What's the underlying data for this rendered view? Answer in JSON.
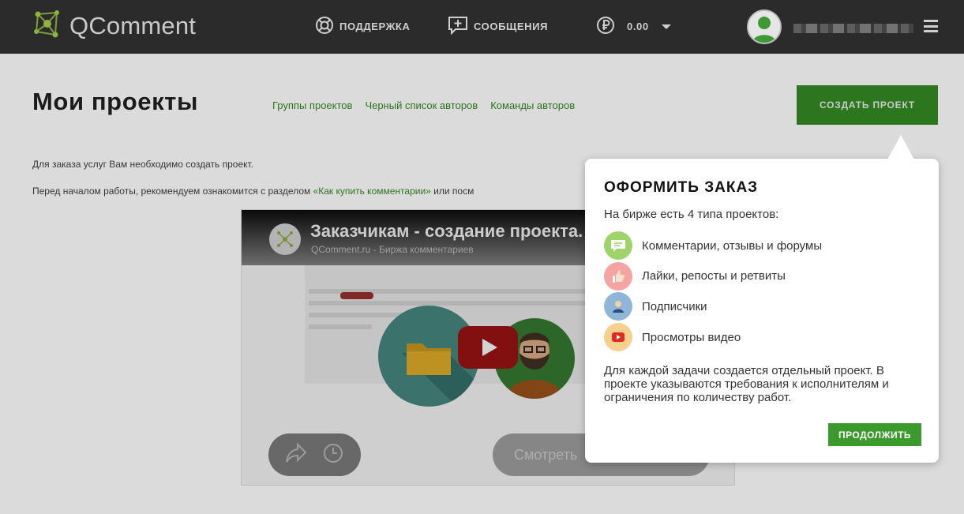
{
  "app": {
    "name": "QComment"
  },
  "header": {
    "nav": {
      "support": "ПОДДЕРЖКА",
      "messages": "СООБЩЕНИЯ",
      "balance": "0.00"
    }
  },
  "main": {
    "title": "Мои проекты",
    "links": [
      "Группы проектов",
      "Черный список авторов",
      "Команды авторов"
    ],
    "create_button": "СОЗДАТЬ ПРОЕКТ",
    "intro": "Для заказа услуг Вам необходимо создать проект.",
    "intro2_prefix": "Перед началом работы, рекомендуем ознакомится с разделом ",
    "intro2_link": "«Как купить комментарии»",
    "intro2_suffix": " или посм"
  },
  "video": {
    "title": "Заказчикам - создание проекта.",
    "channel": "QComment.ru - Биржа комментариев",
    "watch_label": "Смотреть"
  },
  "popover": {
    "title": "ОФОРМИТЬ ЗАКАЗ",
    "subtitle": "На бирже есть 4 типа проектов:",
    "items": [
      {
        "label": "Комментарии, отзывы и форумы",
        "icon": "comment-bubble-icon",
        "color": "#9fd36b"
      },
      {
        "label": "Лайки, репосты и ретвиты",
        "icon": "thumbs-up-icon",
        "color": "#f5a3a3"
      },
      {
        "label": "Подписчики",
        "icon": "subscriber-icon",
        "color": "#8eb6d9"
      },
      {
        "label": "Просмотры видео",
        "icon": "youtube-play-icon",
        "color": "#f7cf8e"
      }
    ],
    "description": "Для каждой задачи создается отдельный проект. В проекте указываются требования к исполнителям и ограничения по количеству работ.",
    "continue_button": "ПРОДОЛЖИТЬ"
  },
  "colors": {
    "header_bg": "#2b2b2b",
    "accent_green": "#2f7f20",
    "button_green": "#3b9a2c",
    "link_green": "#2e7d1e"
  }
}
